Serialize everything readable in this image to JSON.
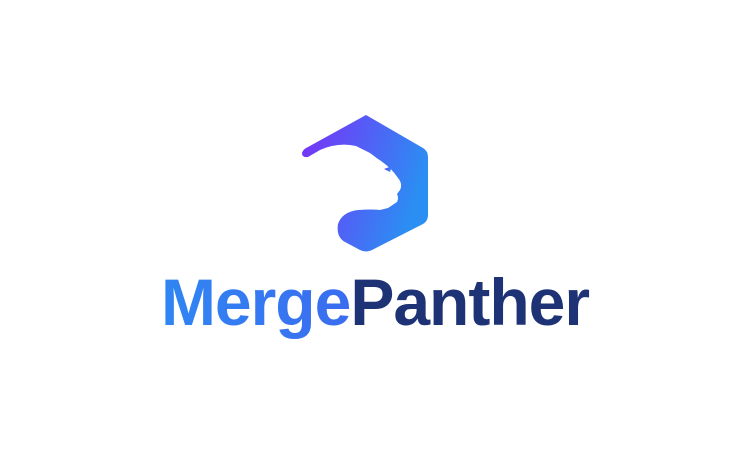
{
  "brand": {
    "name_part_1": "Merge",
    "name_part_2": "Panther",
    "logo_icon": "panther-hexagon-icon"
  },
  "colors": {
    "gradient_start": "#7b2ff7",
    "gradient_end": "#2b8ef3",
    "merge_text": "#3b82f6",
    "panther_text": "#1e3375",
    "background": "#ffffff"
  }
}
